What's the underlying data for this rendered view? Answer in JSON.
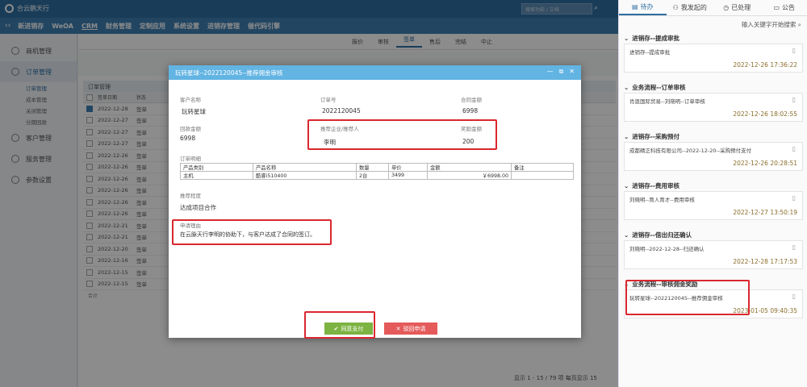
{
  "topbar": {
    "brand": "合云鹏天行",
    "search_placeholder": "搜索功能 / 文档"
  },
  "nav": [
    "新进销存",
    "WeOA",
    "CRM",
    "财务管理",
    "定制应用",
    "系统设置",
    "进销存管理",
    "催代码引擎"
  ],
  "sidebar": {
    "items": [
      "商机管理",
      "订单管理",
      "客户管理",
      "服务管理",
      "参数设置"
    ],
    "subs": [
      "订单管理",
      "成本管理",
      "关闭管理",
      "分期回款"
    ]
  },
  "main": {
    "tabs": [
      "报价",
      "审核",
      "签单",
      "售后",
      "完结",
      "中止"
    ],
    "table_title": "订单管理",
    "columns": [
      "签单日期",
      "状态"
    ],
    "rows": [
      {
        "date": "2022-12-28",
        "state": "签单"
      },
      {
        "date": "2022-12-27",
        "state": "签单"
      },
      {
        "date": "2022-12-27",
        "state": "签单"
      },
      {
        "date": "2022-12-27",
        "state": "签单"
      },
      {
        "date": "2022-12-26",
        "state": "签单"
      },
      {
        "date": "2022-12-26",
        "state": "签单"
      },
      {
        "date": "2022-12-26",
        "state": "签单"
      },
      {
        "date": "2022-12-26",
        "state": "签单"
      },
      {
        "date": "2022-12-26",
        "state": "签单"
      },
      {
        "date": "2022-12-26",
        "state": "签单"
      },
      {
        "date": "2022-12-21",
        "state": "签单"
      },
      {
        "date": "2022-12-21",
        "state": "签单"
      },
      {
        "date": "2022-12-20",
        "state": "签单"
      },
      {
        "date": "2022-12-16",
        "state": "签单"
      },
      {
        "date": "2022-12-15",
        "state": "签单"
      },
      {
        "date": "2022-12-15",
        "state": "签单"
      }
    ],
    "footer": "合计",
    "pager": "显示 1 - 15 / 79 项  每页显示 15"
  },
  "modal": {
    "title": "玩转星球--2022120045--推荐佣金审核",
    "customer_label": "客户名称",
    "customer": "玩转星球",
    "order_no_label": "订单号",
    "order_no": "2022120045",
    "contract_label": "合同金额",
    "contract": "6998",
    "received_label": "回款金额",
    "received": "6998",
    "referrer_label": "推荐企业/推荐人",
    "referrer": "李明",
    "bonus_label": "奖励金额",
    "bonus": "200",
    "detail_label": "订单明细",
    "detail_head": [
      "产品类别",
      "产品名称",
      "数量",
      "单价",
      "金额",
      "备注"
    ],
    "detail_row": [
      "主机",
      "酷睿i510400",
      "2台",
      "3499",
      "￥6998.00",
      ""
    ],
    "degree_label": "推荐程度",
    "degree": "达成项目合作",
    "reason_label": "申请理由",
    "reason": "在云脉天行李明的协助下，与客户达成了合同的签订。",
    "approve": "同意支付",
    "reject": "驳回申请"
  },
  "right": {
    "tabs": [
      "待办",
      "我发起的",
      "已处理",
      "公告"
    ],
    "search": "输入关键字开始搜索",
    "groups": [
      {
        "title": "进销存--提成审批",
        "item": "进销存--提成审批",
        "date": "2022-12-26 17:36:22"
      },
      {
        "title": "业务流程--订单审核",
        "item": "肖恩国际贸易--刘晓明--订单审核",
        "date": "2022-12-26 18:02:55"
      },
      {
        "title": "进销存--采购预付",
        "item": "成都精正科技有限公司--2022-12-20--采购预付支付",
        "date": "2022-12-26 20:28:51"
      },
      {
        "title": "进销存--费用审核",
        "item": "刘晓明--育人育才--费用审核",
        "date": "2022-12-27 13:50:19"
      },
      {
        "title": "进销存--借出归还确认",
        "item": "刘晓明--2022-12-28--归还确认",
        "date": "2022-12-28 17:17:53"
      },
      {
        "title": "业务流程--审核佣金奖励",
        "item": "玩转星球--2022120045--推荐佣金审核",
        "date": "2023-01-05 09:40:35"
      }
    ]
  }
}
